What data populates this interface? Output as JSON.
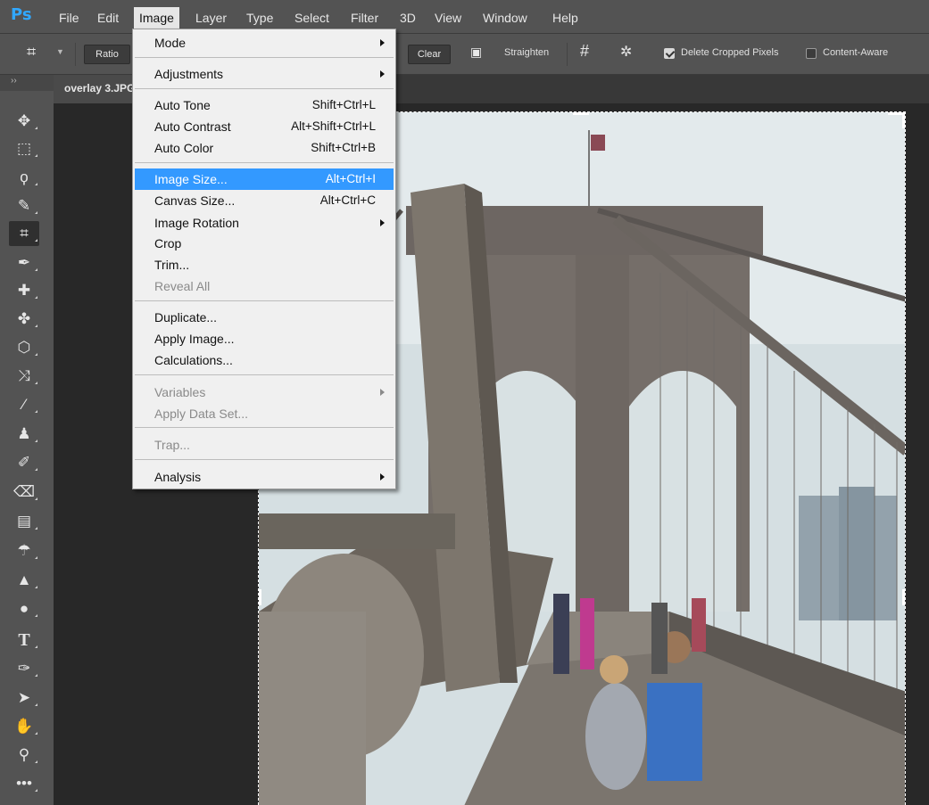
{
  "app": {
    "logo": "Ps"
  },
  "menubar": {
    "items": [
      "File",
      "Edit",
      "Image",
      "Layer",
      "Type",
      "Select",
      "Filter",
      "3D",
      "View",
      "Window",
      "Help"
    ],
    "active": "Image"
  },
  "options": {
    "ratio_label": "Ratio",
    "clear_label": "Clear",
    "straighten_label": "Straighten",
    "delete_cropped_label": "Delete Cropped Pixels",
    "delete_cropped_checked": true,
    "content_aware_label": "Content-Aware",
    "content_aware_checked": false
  },
  "document": {
    "tab_title": "overlay 3.JPG"
  },
  "toolbox": {
    "grip": "››",
    "tools": [
      "move-tool",
      "marquee-tool",
      "lasso-tool",
      "quick-selection-tool",
      "crop-tool",
      "eyedropper-tool",
      "spot-healing-tool",
      "brush-healing-tool",
      "patch-tool",
      "content-aware-move-tool",
      "brush-tool",
      "clone-stamp-tool",
      "history-brush-tool",
      "eraser-tool",
      "gradient-tool",
      "blur-tool",
      "dodge-tool",
      "burn-tool",
      "type-tool",
      "pen-tool",
      "path-selection-tool",
      "hand-tool",
      "zoom-tool",
      "more-tools"
    ],
    "active": "crop-tool"
  },
  "image_menu": {
    "mode": "Mode",
    "adjustments": "Adjustments",
    "auto_tone": "Auto Tone",
    "auto_tone_sc": "Shift+Ctrl+L",
    "auto_contrast": "Auto Contrast",
    "auto_contrast_sc": "Alt+Shift+Ctrl+L",
    "auto_color": "Auto Color",
    "auto_color_sc": "Shift+Ctrl+B",
    "image_size": "Image Size...",
    "image_size_sc": "Alt+Ctrl+I",
    "canvas_size": "Canvas Size...",
    "canvas_size_sc": "Alt+Ctrl+C",
    "image_rotation": "Image Rotation",
    "crop": "Crop",
    "trim": "Trim...",
    "reveal_all": "Reveal All",
    "duplicate": "Duplicate...",
    "apply_image": "Apply Image...",
    "calculations": "Calculations...",
    "variables": "Variables",
    "apply_data_set": "Apply Data Set...",
    "trap": "Trap...",
    "analysis": "Analysis",
    "highlighted": "Image Size..."
  },
  "colors": {
    "menu_highlight": "#3399ff",
    "ps_brand": "#31a8ff",
    "chrome": "#535353"
  }
}
